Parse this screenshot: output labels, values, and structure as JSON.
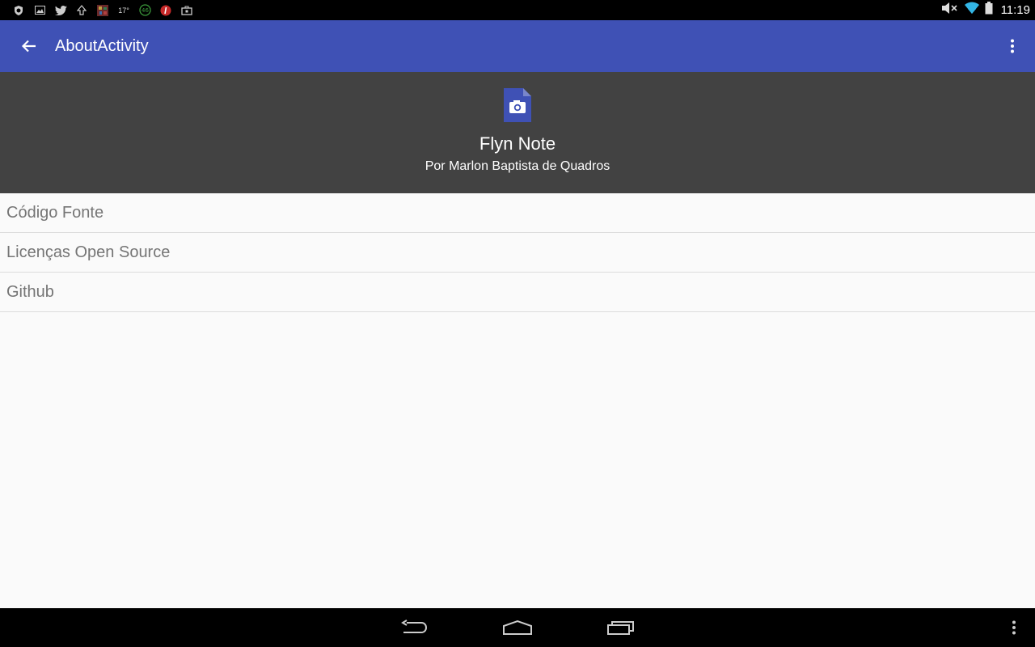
{
  "status_bar": {
    "temperature": "17°",
    "notification_icons": [
      "shield-icon",
      "image-icon",
      "twitter-icon",
      "upload-icon",
      "game-icon",
      "badge-46-icon",
      "flipboard-icon",
      "briefcase-icon"
    ],
    "badge_number": "46",
    "time": "11:19"
  },
  "app_bar": {
    "title": "AboutActivity",
    "color": "#3f51b5"
  },
  "header": {
    "app_name": "Flyn Note",
    "author": "Por Marlon Baptista de Quadros",
    "background": "#424242"
  },
  "list": {
    "items": [
      {
        "label": "Código Fonte"
      },
      {
        "label": "Licenças Open Source"
      },
      {
        "label": "Github"
      }
    ]
  }
}
